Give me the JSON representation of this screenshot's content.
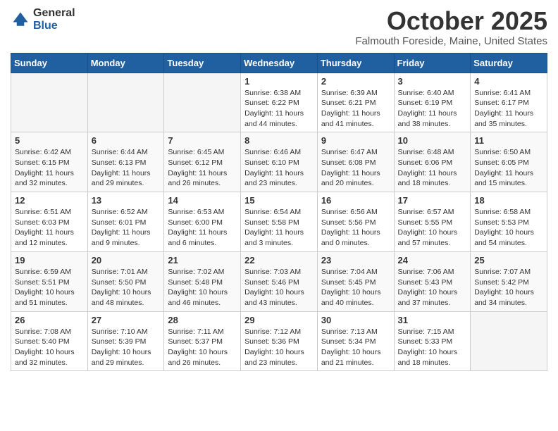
{
  "header": {
    "logo_general": "General",
    "logo_blue": "Blue",
    "month_title": "October 2025",
    "location": "Falmouth Foreside, Maine, United States"
  },
  "days_of_week": [
    "Sunday",
    "Monday",
    "Tuesday",
    "Wednesday",
    "Thursday",
    "Friday",
    "Saturday"
  ],
  "weeks": [
    [
      {
        "day": "",
        "info": ""
      },
      {
        "day": "",
        "info": ""
      },
      {
        "day": "",
        "info": ""
      },
      {
        "day": "1",
        "info": "Sunrise: 6:38 AM\nSunset: 6:22 PM\nDaylight: 11 hours and 44 minutes."
      },
      {
        "day": "2",
        "info": "Sunrise: 6:39 AM\nSunset: 6:21 PM\nDaylight: 11 hours and 41 minutes."
      },
      {
        "day": "3",
        "info": "Sunrise: 6:40 AM\nSunset: 6:19 PM\nDaylight: 11 hours and 38 minutes."
      },
      {
        "day": "4",
        "info": "Sunrise: 6:41 AM\nSunset: 6:17 PM\nDaylight: 11 hours and 35 minutes."
      }
    ],
    [
      {
        "day": "5",
        "info": "Sunrise: 6:42 AM\nSunset: 6:15 PM\nDaylight: 11 hours and 32 minutes."
      },
      {
        "day": "6",
        "info": "Sunrise: 6:44 AM\nSunset: 6:13 PM\nDaylight: 11 hours and 29 minutes."
      },
      {
        "day": "7",
        "info": "Sunrise: 6:45 AM\nSunset: 6:12 PM\nDaylight: 11 hours and 26 minutes."
      },
      {
        "day": "8",
        "info": "Sunrise: 6:46 AM\nSunset: 6:10 PM\nDaylight: 11 hours and 23 minutes."
      },
      {
        "day": "9",
        "info": "Sunrise: 6:47 AM\nSunset: 6:08 PM\nDaylight: 11 hours and 20 minutes."
      },
      {
        "day": "10",
        "info": "Sunrise: 6:48 AM\nSunset: 6:06 PM\nDaylight: 11 hours and 18 minutes."
      },
      {
        "day": "11",
        "info": "Sunrise: 6:50 AM\nSunset: 6:05 PM\nDaylight: 11 hours and 15 minutes."
      }
    ],
    [
      {
        "day": "12",
        "info": "Sunrise: 6:51 AM\nSunset: 6:03 PM\nDaylight: 11 hours and 12 minutes."
      },
      {
        "day": "13",
        "info": "Sunrise: 6:52 AM\nSunset: 6:01 PM\nDaylight: 11 hours and 9 minutes."
      },
      {
        "day": "14",
        "info": "Sunrise: 6:53 AM\nSunset: 6:00 PM\nDaylight: 11 hours and 6 minutes."
      },
      {
        "day": "15",
        "info": "Sunrise: 6:54 AM\nSunset: 5:58 PM\nDaylight: 11 hours and 3 minutes."
      },
      {
        "day": "16",
        "info": "Sunrise: 6:56 AM\nSunset: 5:56 PM\nDaylight: 11 hours and 0 minutes."
      },
      {
        "day": "17",
        "info": "Sunrise: 6:57 AM\nSunset: 5:55 PM\nDaylight: 10 hours and 57 minutes."
      },
      {
        "day": "18",
        "info": "Sunrise: 6:58 AM\nSunset: 5:53 PM\nDaylight: 10 hours and 54 minutes."
      }
    ],
    [
      {
        "day": "19",
        "info": "Sunrise: 6:59 AM\nSunset: 5:51 PM\nDaylight: 10 hours and 51 minutes."
      },
      {
        "day": "20",
        "info": "Sunrise: 7:01 AM\nSunset: 5:50 PM\nDaylight: 10 hours and 48 minutes."
      },
      {
        "day": "21",
        "info": "Sunrise: 7:02 AM\nSunset: 5:48 PM\nDaylight: 10 hours and 46 minutes."
      },
      {
        "day": "22",
        "info": "Sunrise: 7:03 AM\nSunset: 5:46 PM\nDaylight: 10 hours and 43 minutes."
      },
      {
        "day": "23",
        "info": "Sunrise: 7:04 AM\nSunset: 5:45 PM\nDaylight: 10 hours and 40 minutes."
      },
      {
        "day": "24",
        "info": "Sunrise: 7:06 AM\nSunset: 5:43 PM\nDaylight: 10 hours and 37 minutes."
      },
      {
        "day": "25",
        "info": "Sunrise: 7:07 AM\nSunset: 5:42 PM\nDaylight: 10 hours and 34 minutes."
      }
    ],
    [
      {
        "day": "26",
        "info": "Sunrise: 7:08 AM\nSunset: 5:40 PM\nDaylight: 10 hours and 32 minutes."
      },
      {
        "day": "27",
        "info": "Sunrise: 7:10 AM\nSunset: 5:39 PM\nDaylight: 10 hours and 29 minutes."
      },
      {
        "day": "28",
        "info": "Sunrise: 7:11 AM\nSunset: 5:37 PM\nDaylight: 10 hours and 26 minutes."
      },
      {
        "day": "29",
        "info": "Sunrise: 7:12 AM\nSunset: 5:36 PM\nDaylight: 10 hours and 23 minutes."
      },
      {
        "day": "30",
        "info": "Sunrise: 7:13 AM\nSunset: 5:34 PM\nDaylight: 10 hours and 21 minutes."
      },
      {
        "day": "31",
        "info": "Sunrise: 7:15 AM\nSunset: 5:33 PM\nDaylight: 10 hours and 18 minutes."
      },
      {
        "day": "",
        "info": ""
      }
    ]
  ]
}
